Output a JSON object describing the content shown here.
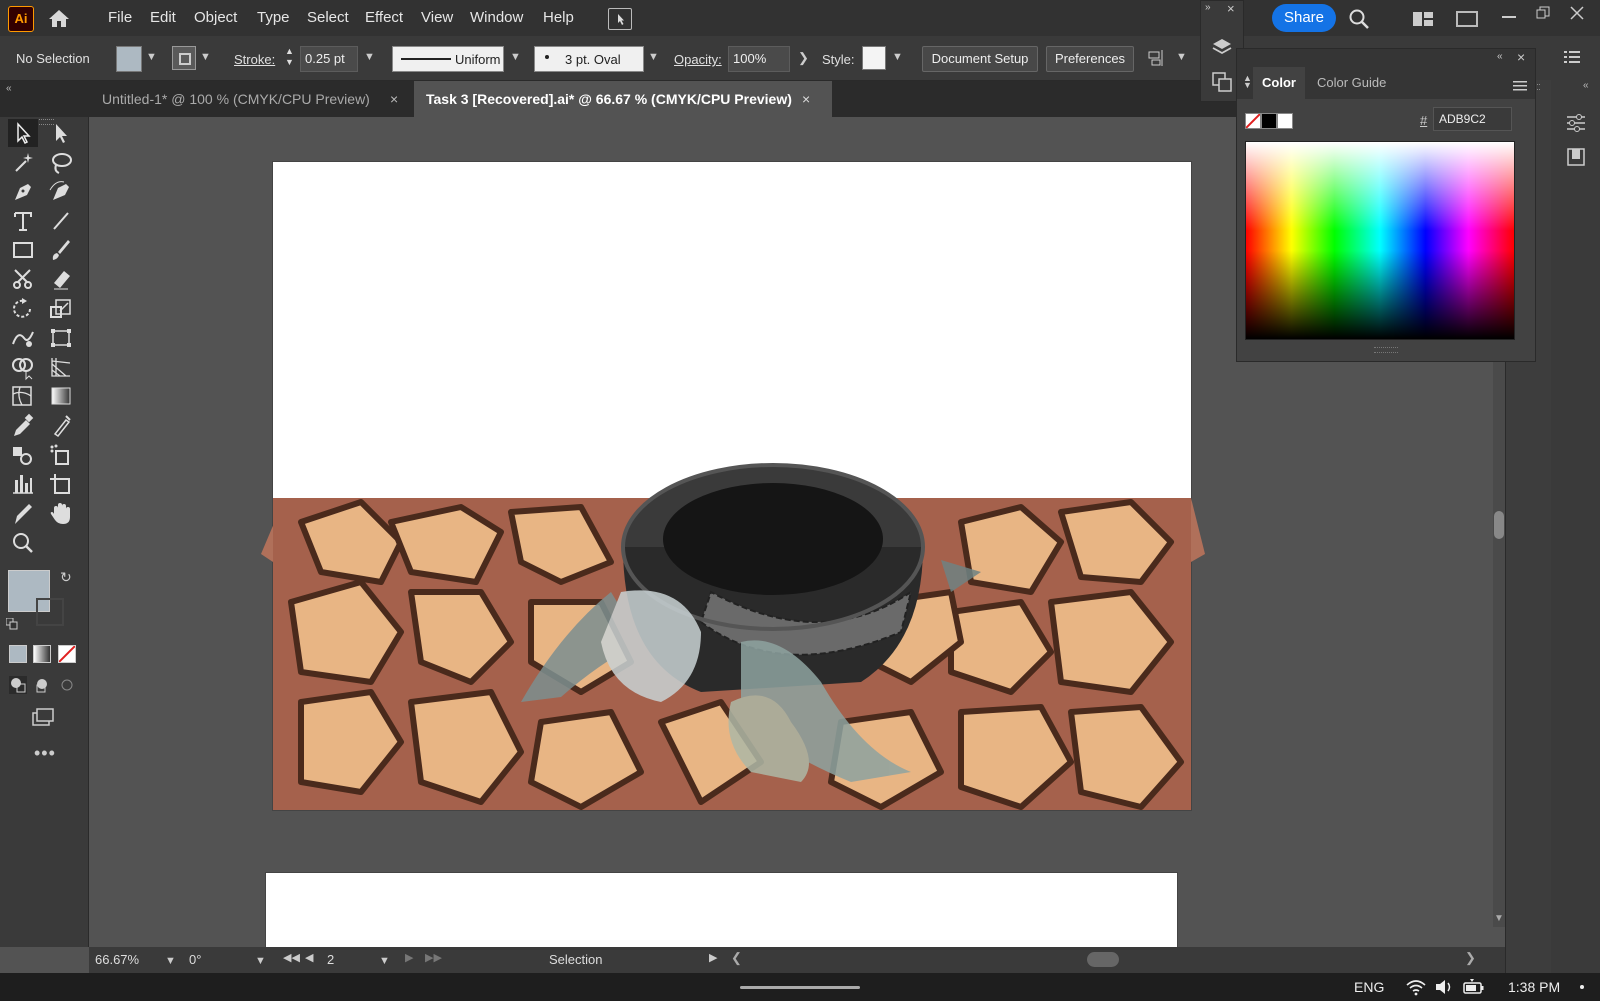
{
  "app": {
    "logo": "Ai"
  },
  "menu": [
    "File",
    "Edit",
    "Object",
    "Type",
    "Select",
    "Effect",
    "View",
    "Window",
    "Help"
  ],
  "share_label": "Share",
  "controls": {
    "selection_status": "No Selection",
    "stroke_label": "Stroke:",
    "stroke_value": "0.25 pt",
    "stroke_profile": "Uniform",
    "brush": "3 pt. Oval",
    "opacity_label": "Opacity:",
    "opacity_value": "100%",
    "style_label": "Style:",
    "document_setup": "Document Setup",
    "preferences": "Preferences"
  },
  "tabs": [
    {
      "label": "Untitled-1* @ 100 % (CMYK/CPU Preview)",
      "active": false
    },
    {
      "label": "Task 3 [Recovered].ai* @ 66.67 % (CMYK/CPU Preview)",
      "active": true
    }
  ],
  "color_panel": {
    "tab_color": "Color",
    "tab_guide": "Color Guide",
    "hash": "#",
    "hex_value": "ADB9C2"
  },
  "status": {
    "zoom": "66.67%",
    "rotation": "0°",
    "artboard": "2",
    "tool": "Selection"
  },
  "taskbar": {
    "lang": "ENG",
    "time": "1:38 PM"
  },
  "colors": {
    "fill": "#ADB9C2",
    "accent": "#1473e6",
    "ground": "#b0705a",
    "rock": "#e8b584"
  },
  "tools": [
    "selection-tool",
    "direct-selection-tool",
    "magic-wand-tool",
    "lasso-tool",
    "pen-tool",
    "curvature-tool",
    "type-tool",
    "line-tool",
    "rectangle-tool",
    "paintbrush-tool",
    "scissors-tool",
    "eraser-tool",
    "rotate-tool",
    "scale-tool",
    "warp-tool",
    "free-transform-tool",
    "shape-builder-tool",
    "perspective-grid-tool",
    "mesh-tool",
    "gradient-tool",
    "eyedropper-tool",
    "blend-tool",
    "symbol-sprayer-tool",
    "live-paint-tool",
    "column-graph-tool",
    "artboard-tool",
    "slice-tool",
    "hand-tool",
    "zoom-tool"
  ]
}
